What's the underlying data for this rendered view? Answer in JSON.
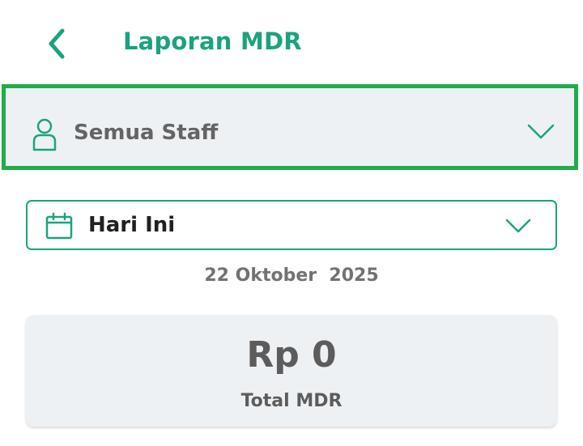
{
  "header": {
    "title": "Laporan MDR",
    "back_icon": "chevron-left-icon"
  },
  "staff_filter": {
    "selected": "Semua Staff",
    "icon": "person-icon"
  },
  "period_filter": {
    "selected": "Hari Ini",
    "icon": "calendar-icon"
  },
  "date_display": "22 Oktober  2025",
  "summary": {
    "amount": "Rp 0",
    "caption": "Total MDR"
  },
  "colors": {
    "accent": "#1aa37e",
    "highlight_border": "#1fad4a",
    "card_background": "#eef1f4"
  }
}
